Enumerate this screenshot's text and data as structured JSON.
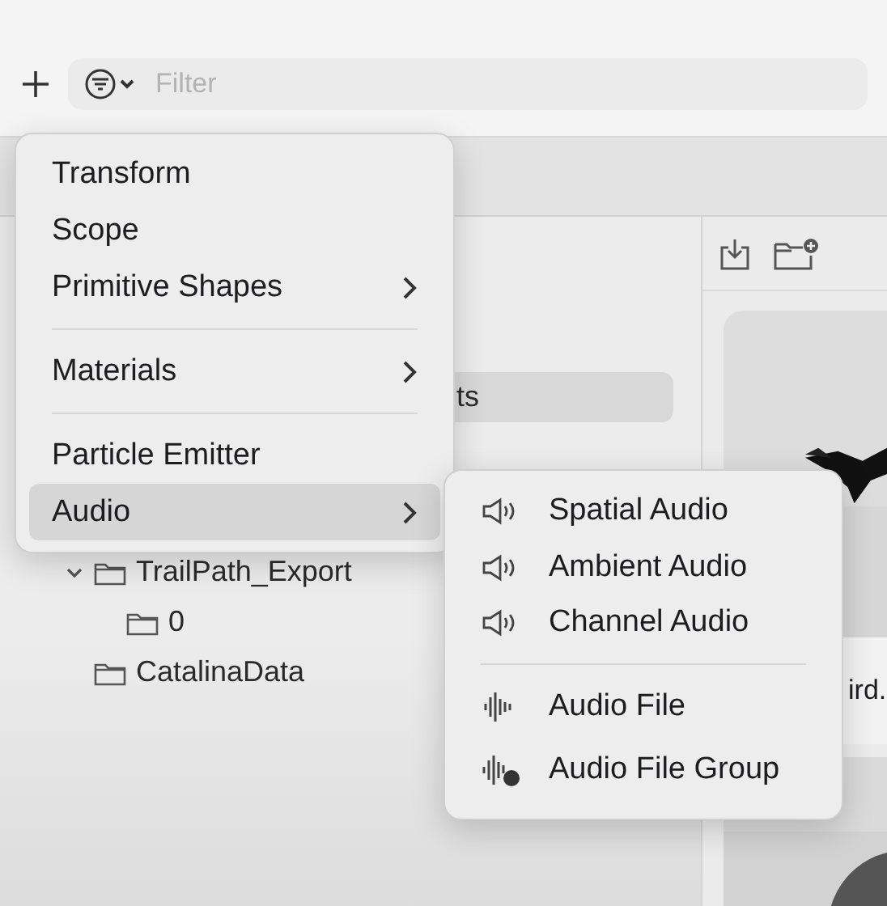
{
  "toolbar": {
    "filter": {
      "placeholder": "Filter"
    }
  },
  "tree": [
    {
      "kind": "clipped",
      "label": "ts",
      "selected": true
    },
    {
      "kind": "row",
      "label": "TrailPath_Export",
      "selected": false,
      "expanded": true,
      "children": [
        {
          "kind": "row",
          "label": "0",
          "selected": false
        }
      ]
    },
    {
      "kind": "row",
      "label": "CatalinaData",
      "selected": false
    }
  ],
  "menu": {
    "items": [
      {
        "kind": "item",
        "label": "Transform",
        "submenu": false,
        "selected": false
      },
      {
        "kind": "item",
        "label": "Scope",
        "submenu": false,
        "selected": false
      },
      {
        "kind": "item",
        "label": "Primitive Shapes",
        "submenu": true,
        "selected": false
      },
      {
        "kind": "divider"
      },
      {
        "kind": "item",
        "label": "Materials",
        "submenu": true,
        "selected": false
      },
      {
        "kind": "divider"
      },
      {
        "kind": "item",
        "label": "Particle Emitter",
        "submenu": false,
        "selected": false
      },
      {
        "kind": "item",
        "label": "Audio",
        "submenu": true,
        "selected": true
      }
    ]
  },
  "submenu": {
    "items": [
      {
        "kind": "speaker",
        "label": "Spatial Audio"
      },
      {
        "kind": "speaker",
        "label": "Ambient Audio"
      },
      {
        "kind": "speaker",
        "label": "Channel Audio"
      },
      {
        "kind": "divider"
      },
      {
        "kind": "waveform",
        "label": "Audio File"
      },
      {
        "kind": "waveform-group",
        "label": "Audio File Group"
      }
    ]
  },
  "assets": {
    "cards": [
      {
        "kind": "bird",
        "caption": "ird."
      },
      {
        "kind": "circle"
      }
    ]
  }
}
